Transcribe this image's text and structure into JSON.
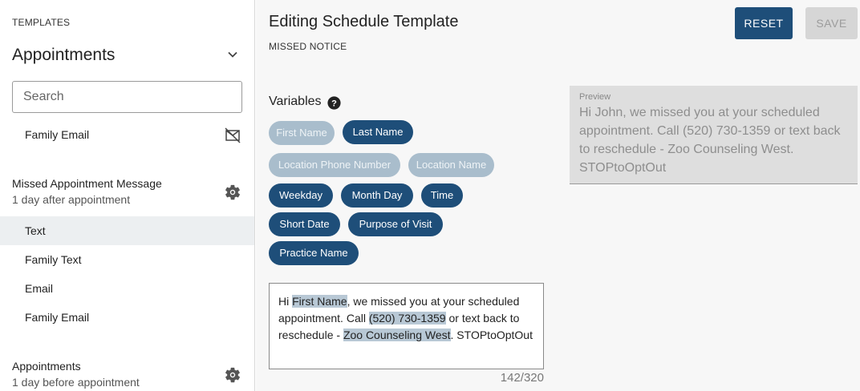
{
  "sidebar": {
    "section_label": "TEMPLATES",
    "title": "Appointments",
    "search_placeholder": "Search",
    "top_item": "Family Email",
    "groups": [
      {
        "title": "Missed Appointment Message",
        "subtitle": "1 day after appointment",
        "items": [
          "Text",
          "Family Text",
          "Email",
          "Family Email"
        ]
      },
      {
        "title": "Appointments",
        "subtitle": "1 day before appointment"
      }
    ]
  },
  "header": {
    "title": "Editing Schedule Template",
    "subtitle": "MISSED NOTICE",
    "reset_label": "RESET",
    "save_label": "SAVE"
  },
  "variables": {
    "label": "Variables",
    "chips": [
      {
        "label": "First Name",
        "active": false
      },
      {
        "label": "Last Name",
        "active": true
      },
      {
        "label": "Location Phone Number",
        "active": false
      },
      {
        "label": "Location Name",
        "active": false
      },
      {
        "label": "Weekday",
        "active": true
      },
      {
        "label": "Month Day",
        "active": true
      },
      {
        "label": "Time",
        "active": true
      },
      {
        "label": "Short Date",
        "active": true
      },
      {
        "label": "Purpose of Visit",
        "active": true
      },
      {
        "label": "Practice Name",
        "active": true
      }
    ]
  },
  "editor": {
    "segments": [
      {
        "text": "Hi ",
        "var": false
      },
      {
        "text": "First Name",
        "var": true
      },
      {
        "text": ", we missed you at your scheduled appointment. Call ",
        "var": false
      },
      {
        "text": "(520) 730-1359",
        "var": true
      },
      {
        "text": " or text back to reschedule - ",
        "var": false
      },
      {
        "text": "Zoo Counseling West",
        "var": true
      },
      {
        "text": ". STOPtoOptOut",
        "var": false
      }
    ],
    "counter": "142/320"
  },
  "preview": {
    "label": "Preview",
    "text": "Hi John, we missed you at your scheduled appointment. Call (520) 730-1359 or text back to reschedule - Zoo Counseling West. STOPtoOptOut"
  },
  "colors": {
    "primary": "#1e4e79",
    "chip_inactive": "#a9bdcc",
    "highlight": "#b8c8d5",
    "active_row": "#eceff1"
  }
}
